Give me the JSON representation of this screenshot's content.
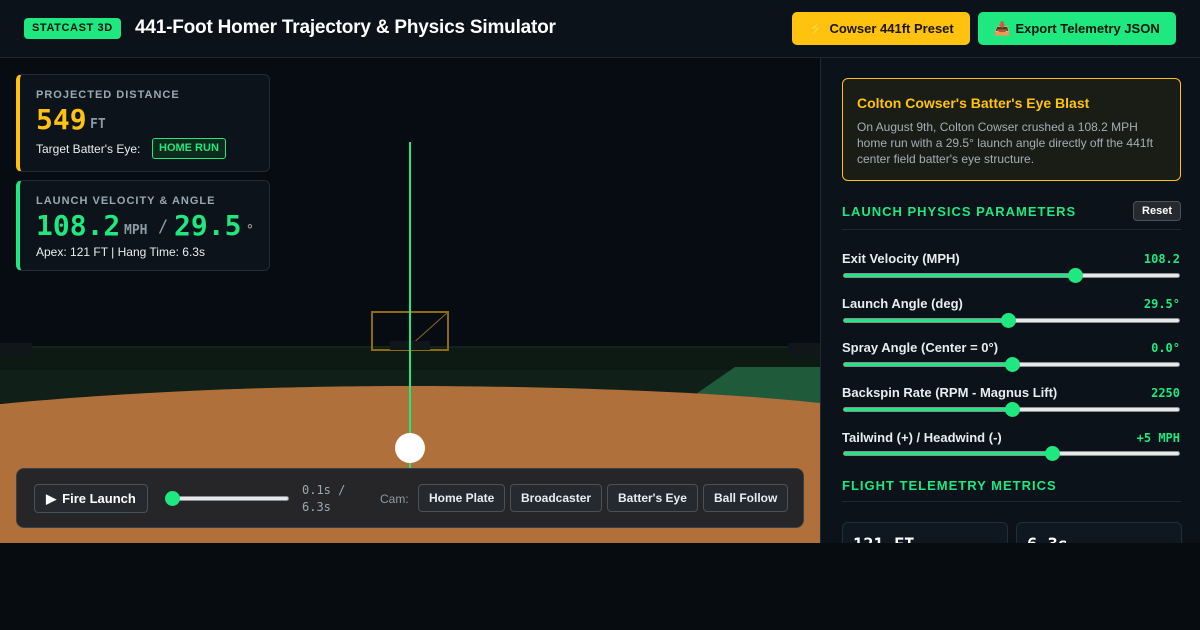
{
  "header": {
    "badge": "STATCAST 3D",
    "title": "441-Foot Homer Trajectory & Physics Simulator",
    "preset_icon": "⚡",
    "preset_label": "Cowser 441ft Preset",
    "export_icon": "📥",
    "export_label": "Export Telemetry JSON",
    "colors": {
      "accent_green": "#1ee87f",
      "accent_yellow": "#ffc20e"
    }
  },
  "overlay": {
    "distance": {
      "label": "PROJECTED DISTANCE",
      "value": "549",
      "unit": "FT",
      "target_label": "Target Batter's Eye:",
      "result_badge": "HOME RUN"
    },
    "launch": {
      "label": "LAUNCH VELOCITY & ANGLE",
      "velocity": "108.2",
      "velocity_unit": "MPH",
      "separator": "/",
      "angle": "29.5",
      "angle_unit": "°",
      "apex_text": "Apex: 121 FT | Hang Time: 6.3s"
    }
  },
  "controls": {
    "fire_icon": "▶",
    "fire_label": "Fire Launch",
    "timeline_progress": 0.016,
    "time_text": "0.1s / 6.3s",
    "cam_label": "Cam:",
    "cameras": [
      {
        "label": "Home Plate",
        "active": true
      },
      {
        "label": "Broadcaster",
        "active": false
      },
      {
        "label": "Batter's Eye",
        "active": false
      },
      {
        "label": "Ball Follow",
        "active": false
      }
    ]
  },
  "sidebar": {
    "story": {
      "title": "Colton Cowser's Batter's Eye Blast",
      "text": "On August 9th, Colton Cowser crushed a 108.2 MPH home run with a 29.5° launch angle directly off the 441ft center field batter's eye structure."
    },
    "params_heading": "LAUNCH PHYSICS PARAMETERS",
    "reset_label": "Reset",
    "params": [
      {
        "label": "Exit Velocity (MPH)",
        "value": "108.2",
        "fraction": 0.69
      },
      {
        "label": "Launch Angle (deg)",
        "value": "29.5°",
        "fraction": 0.49
      },
      {
        "label": "Spray Angle (Center = 0°)",
        "value": "0.0°",
        "fraction": 0.5
      },
      {
        "label": "Backspin Rate (RPM - Magnus Lift)",
        "value": "2250",
        "fraction": 0.5
      },
      {
        "label": "Tailwind (+) / Headwind (-)",
        "value": "+5 MPH",
        "fraction": 0.62
      }
    ],
    "telemetry_heading": "FLIGHT TELEMETRY METRICS",
    "metrics": [
      {
        "value": "121 FT"
      },
      {
        "value": "6.3s"
      }
    ]
  }
}
